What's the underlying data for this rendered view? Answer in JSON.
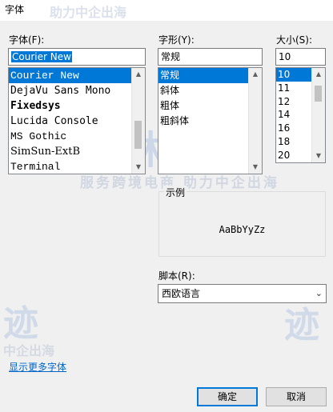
{
  "window": {
    "title": "字体"
  },
  "watermark": {
    "line1": "助力中企出海",
    "logo": "玉林阳迹",
    "slogan": "服务跨境电商 助力中企出海",
    "left_logo": "迹",
    "left_slogan": "中企出海",
    "right_logo": "迹"
  },
  "font": {
    "label": "字体(F):",
    "value": "Courier New",
    "items": [
      {
        "label": "Courier New",
        "family": "\"Liberation Mono\", monospace",
        "weight": "normal"
      },
      {
        "label": "DejaVu Sans Mono",
        "family": "\"DejaVu Sans Mono\", monospace",
        "weight": "normal"
      },
      {
        "label": "Fixedsys",
        "family": "\"DejaVu Sans Mono\", monospace",
        "weight": "bold"
      },
      {
        "label": "Lucida Console",
        "family": "\"DejaVu Sans Mono\", monospace",
        "weight": "normal"
      },
      {
        "label": "MS Gothic",
        "family": "\"Liberation Mono\", monospace",
        "weight": "normal"
      },
      {
        "label": "SimSun-ExtB",
        "family": "\"DejaVu Serif\", serif",
        "weight": "normal"
      },
      {
        "label": "Terminal",
        "family": "\"Liberation Mono\", monospace",
        "weight": "normal"
      }
    ],
    "selected_index": 0
  },
  "style": {
    "label": "字形(Y):",
    "value": "常规",
    "items": [
      "常规",
      "斜体",
      "粗体",
      "粗斜体"
    ],
    "selected_index": 0
  },
  "size": {
    "label": "大小(S):",
    "value": "10",
    "items": [
      "10",
      "11",
      "12",
      "14",
      "16",
      "18",
      "20"
    ],
    "selected_index": 0
  },
  "sample": {
    "label": "示例",
    "text": "AaBbYyZz"
  },
  "script": {
    "label": "脚本(R):",
    "value": "西欧语言"
  },
  "more_fonts_link": "显示更多字体",
  "buttons": {
    "ok": "确定",
    "cancel": "取消"
  },
  "colors": {
    "selection": "#0078d7",
    "link": "#0066cc"
  }
}
